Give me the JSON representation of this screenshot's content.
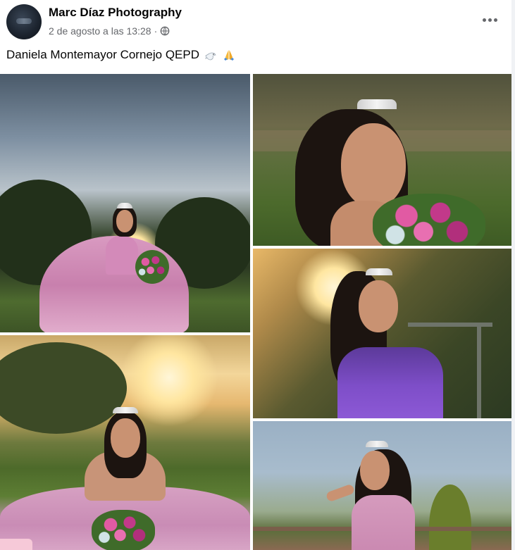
{
  "post": {
    "page_name": "Marc Díaz Photography",
    "timestamp": "2 de agosto a las 13:28",
    "separator": "·",
    "audience_icon": "globe-icon",
    "more_icon": "more-options-icon",
    "caption": "Daniela Montemayor Cornejo QEPD",
    "caption_emojis": [
      "dove-icon",
      "folded-hands-icon"
    ]
  },
  "photos": [
    {
      "name": "photo-1",
      "description_icon": "photo"
    },
    {
      "name": "photo-2",
      "description_icon": "photo"
    },
    {
      "name": "photo-3",
      "description_icon": "photo"
    },
    {
      "name": "photo-4",
      "description_icon": "photo"
    },
    {
      "name": "photo-5",
      "description_icon": "photo"
    }
  ],
  "colors": {
    "text_primary": "#050505",
    "text_secondary": "#65676b",
    "card_bg": "#ffffff",
    "page_bg": "#f0f2f5"
  }
}
